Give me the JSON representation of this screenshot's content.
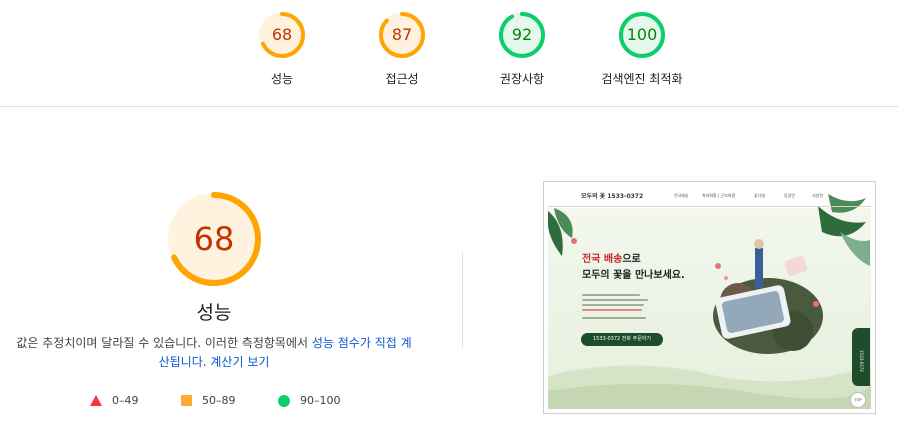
{
  "categories": [
    {
      "label": "성능",
      "score": "68",
      "value": 68,
      "color": "#ffa400",
      "bg": "#fff3e0",
      "text_color": "#c33300"
    },
    {
      "label": "접근성",
      "score": "87",
      "value": 87,
      "color": "#ffa400",
      "bg": "#fff3e0",
      "text_color": "#c33300"
    },
    {
      "label": "권장사항",
      "score": "92",
      "value": 92,
      "color": "#0cce6b",
      "bg": "#e6f7ed",
      "text_color": "#008800"
    },
    {
      "label": "검색엔진 최적화",
      "score": "100",
      "value": 100,
      "color": "#0cce6b",
      "bg": "#e6f7ed",
      "text_color": "#008800"
    }
  ],
  "performance": {
    "score": "68",
    "value": 68,
    "title": "성능",
    "desc_prefix": "값은 추정치이며 달라질 수 있습니다. 이러한 측정항목에서 ",
    "desc_link1": "성능 점수가 직접 계산됩니다",
    "desc_middle": ". ",
    "desc_link2": "계산기 보기"
  },
  "legend": [
    {
      "range": "0–49",
      "shape": "triangle",
      "color": "#ff3333"
    },
    {
      "range": "50–89",
      "shape": "square",
      "color": "#ffaa33"
    },
    {
      "range": "90–100",
      "shape": "circle",
      "color": "#0cce6b"
    }
  ],
  "thumbnail": {
    "logo": "모두의 꽃 1533-0372",
    "nav": [
      "전국배송",
      "축하화환 | 근조화환",
      "꽃다발",
      "동양란",
      "서양란"
    ],
    "hero_red": "전국 배송",
    "hero_dark": "으로",
    "hero_line2": "모두의 꽃을 만나보세요.",
    "call_button": "1533-0372 전화 주문하기",
    "side_tab": "1533-0372",
    "top_button": "TOP"
  }
}
